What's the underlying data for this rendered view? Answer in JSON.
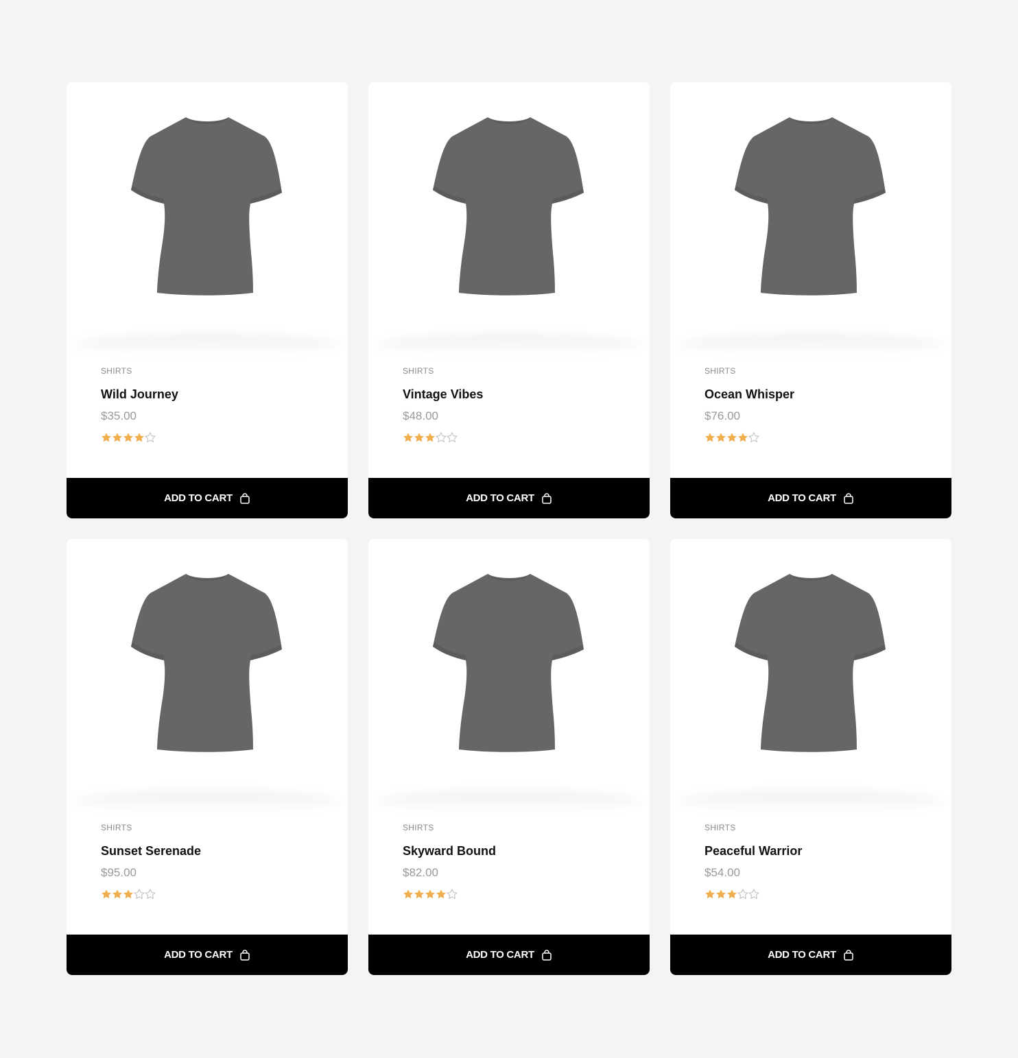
{
  "products": [
    {
      "category": "SHIRTS",
      "name": "Wild Journey",
      "price": "$35.00",
      "rating": 4,
      "rating_max": 5,
      "button_label": "ADD TO CART"
    },
    {
      "category": "SHIRTS",
      "name": "Vintage Vibes",
      "price": "$48.00",
      "rating": 3,
      "rating_max": 5,
      "button_label": "ADD TO CART"
    },
    {
      "category": "SHIRTS",
      "name": "Ocean Whisper",
      "price": "$76.00",
      "rating": 4,
      "rating_max": 5,
      "button_label": "ADD TO CART"
    },
    {
      "category": "SHIRTS",
      "name": "Sunset Serenade",
      "price": "$95.00",
      "rating": 3,
      "rating_max": 5,
      "button_label": "ADD TO CART"
    },
    {
      "category": "SHIRTS",
      "name": "Skyward Bound",
      "price": "$82.00",
      "rating": 4,
      "rating_max": 5,
      "button_label": "ADD TO CART"
    },
    {
      "category": "SHIRTS",
      "name": "Peaceful Warrior",
      "price": "$54.00",
      "rating": 3,
      "rating_max": 5,
      "button_label": "ADD TO CART"
    }
  ],
  "colors": {
    "background": "#f4f4f4",
    "card": "#ffffff",
    "button": "#000000",
    "button_text": "#ffffff",
    "star_filled": "#f0ad4e",
    "star_empty": "#bdbdbd",
    "shirt": "#666666",
    "category_text": "#8a8a8a",
    "price_text": "#999999"
  },
  "icons": {
    "product_image": "tshirt-icon",
    "button_icon": "shopping-bag-icon",
    "rating": "star-icon"
  }
}
